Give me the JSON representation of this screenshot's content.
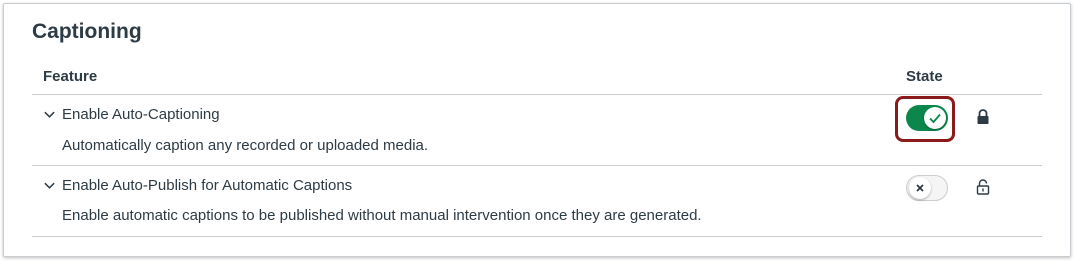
{
  "section": {
    "title": "Captioning"
  },
  "table": {
    "headers": {
      "feature": "Feature",
      "state": "State"
    },
    "rows": [
      {
        "title": "Enable Auto-Captioning",
        "description": "Automatically caption any recorded or uploaded media.",
        "state": "on",
        "locked": true,
        "icons": [
          "chevron-down-icon",
          "checkmark-icon",
          "lock-icon"
        ]
      },
      {
        "title": "Enable Auto-Publish for Automatic Captions",
        "description": "Enable automatic captions to be published without manual intervention once they are generated.",
        "state": "off",
        "locked": false,
        "icons": [
          "chevron-down-icon",
          "x-icon",
          "unlock-icon"
        ]
      }
    ]
  },
  "colors": {
    "toggle_on": "#0b874b",
    "focus_ring": "#8b1a1a",
    "text": "#2d3b45",
    "divider": "#c7cdd1"
  }
}
